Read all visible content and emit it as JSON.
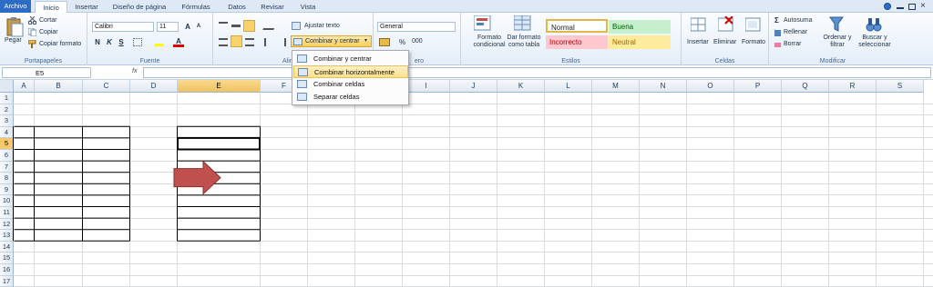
{
  "tabs": [
    "Archivo",
    "Inicio",
    "Insertar",
    "Diseño de página",
    "Fórmulas",
    "Datos",
    "Revisar",
    "Vista"
  ],
  "clipboard": {
    "paste": "Pegar",
    "cut": "Cortar",
    "copy": "Copiar",
    "format_painter": "Copiar formato",
    "label": "Portapapeles"
  },
  "font": {
    "name": "Calibri",
    "size": "11",
    "bold": "N",
    "italic": "K",
    "underline": "S",
    "label": "Fuente"
  },
  "alignment": {
    "wrap": "Ajustar texto",
    "merge": "Combinar y centrar",
    "label": "Alineac"
  },
  "number": {
    "format": "General",
    "percent": "%",
    "thousands": "000",
    "label": "ero"
  },
  "styles": {
    "conditional": "Formato condicional",
    "as_table": "Dar formato como tabla",
    "normal": "Normal",
    "good": "Buena",
    "bad": "Incorrecto",
    "neutral": "Neutral",
    "label": "Estilos"
  },
  "cells": {
    "insert": "Insertar",
    "delete": "Eliminar",
    "format": "Formato",
    "label": "Celdas"
  },
  "editing": {
    "autosum": "Autosuma",
    "fill": "Rellenar",
    "clear": "Borrar",
    "sort": "Ordenar y filtrar",
    "find": "Buscar y seleccionar",
    "label": "Modificar"
  },
  "formula_bar": {
    "name_box": "E5",
    "fx": "fx"
  },
  "merge_menu": [
    "Combinar y centrar",
    "Combinar horizontalmente",
    "Combinar celdas",
    "Separar celdas"
  ],
  "columns": [
    "A",
    "B",
    "C",
    "D",
    "E",
    "F",
    "G",
    "H",
    "I",
    "J",
    "K",
    "L",
    "M",
    "N",
    "O",
    "P",
    "Q",
    "R",
    "S"
  ],
  "rows": [
    "1",
    "2",
    "3",
    "4",
    "5",
    "6",
    "7",
    "8",
    "9",
    "10",
    "11",
    "12",
    "13",
    "14",
    "15",
    "16",
    "17"
  ],
  "colors": {
    "accent": "#2a6cc6",
    "arrow": "#c0504d",
    "selected_header": "#f5c969"
  }
}
